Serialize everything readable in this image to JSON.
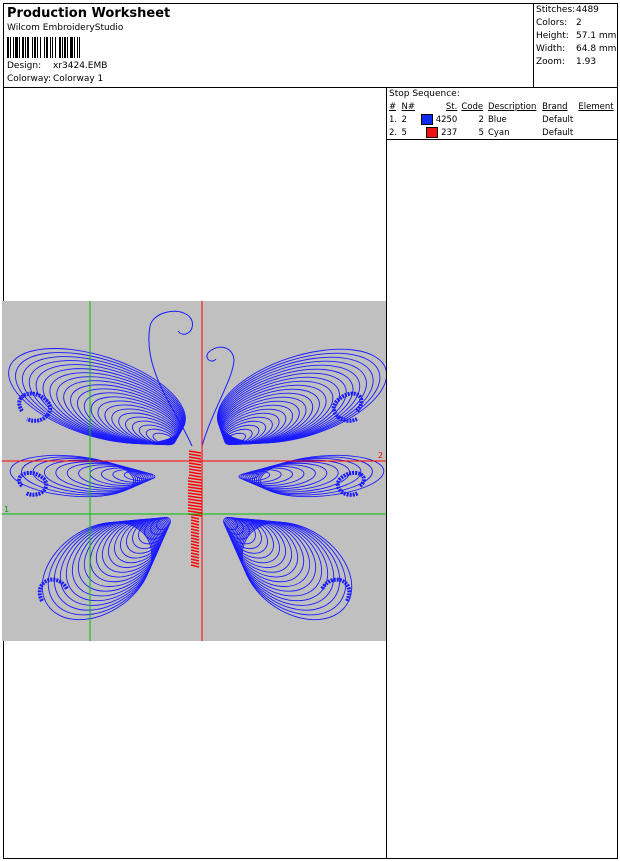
{
  "header": {
    "title": "Production Worksheet",
    "software": "Wilcom EmbroideryStudio",
    "design_label": "Design:",
    "design_value": "xr3424.EMB",
    "colorway_label": "Colorway:",
    "colorway_value": "Colorway 1"
  },
  "stats": {
    "stitches_label": "Stitches:",
    "stitches_value": "4489",
    "colors_label": "Colors:",
    "colors_value": "2",
    "height_label": "Height:",
    "height_value": "57.1 mm",
    "width_label": "Width:",
    "width_value": "64.8 mm",
    "zoom_label": "Zoom:",
    "zoom_value": "1.93"
  },
  "stop_sequence": {
    "title": "Stop Sequence:",
    "columns": [
      "#",
      "N#",
      "St.",
      "Code",
      "Description",
      "Brand",
      "Element"
    ],
    "rows": [
      {
        "num": "1.",
        "n": "2",
        "color": "#0b2cf0",
        "st": "4250",
        "code": "2",
        "description": "Blue",
        "brand": "Default",
        "element": ""
      },
      {
        "num": "2.",
        "n": "5",
        "color": "#ee1111",
        "st": "237",
        "code": "5",
        "description": "Cyan",
        "brand": "Default",
        "element": ""
      }
    ]
  },
  "design_preview": {
    "thread_colors": {
      "wings": "#1a1aff",
      "body": "#ff0000"
    },
    "background": "#c0c0c0",
    "guide_colors": {
      "red": "#ff0000",
      "green": "#00c000"
    },
    "guide_labels": {
      "red": "2",
      "green": "1"
    }
  }
}
